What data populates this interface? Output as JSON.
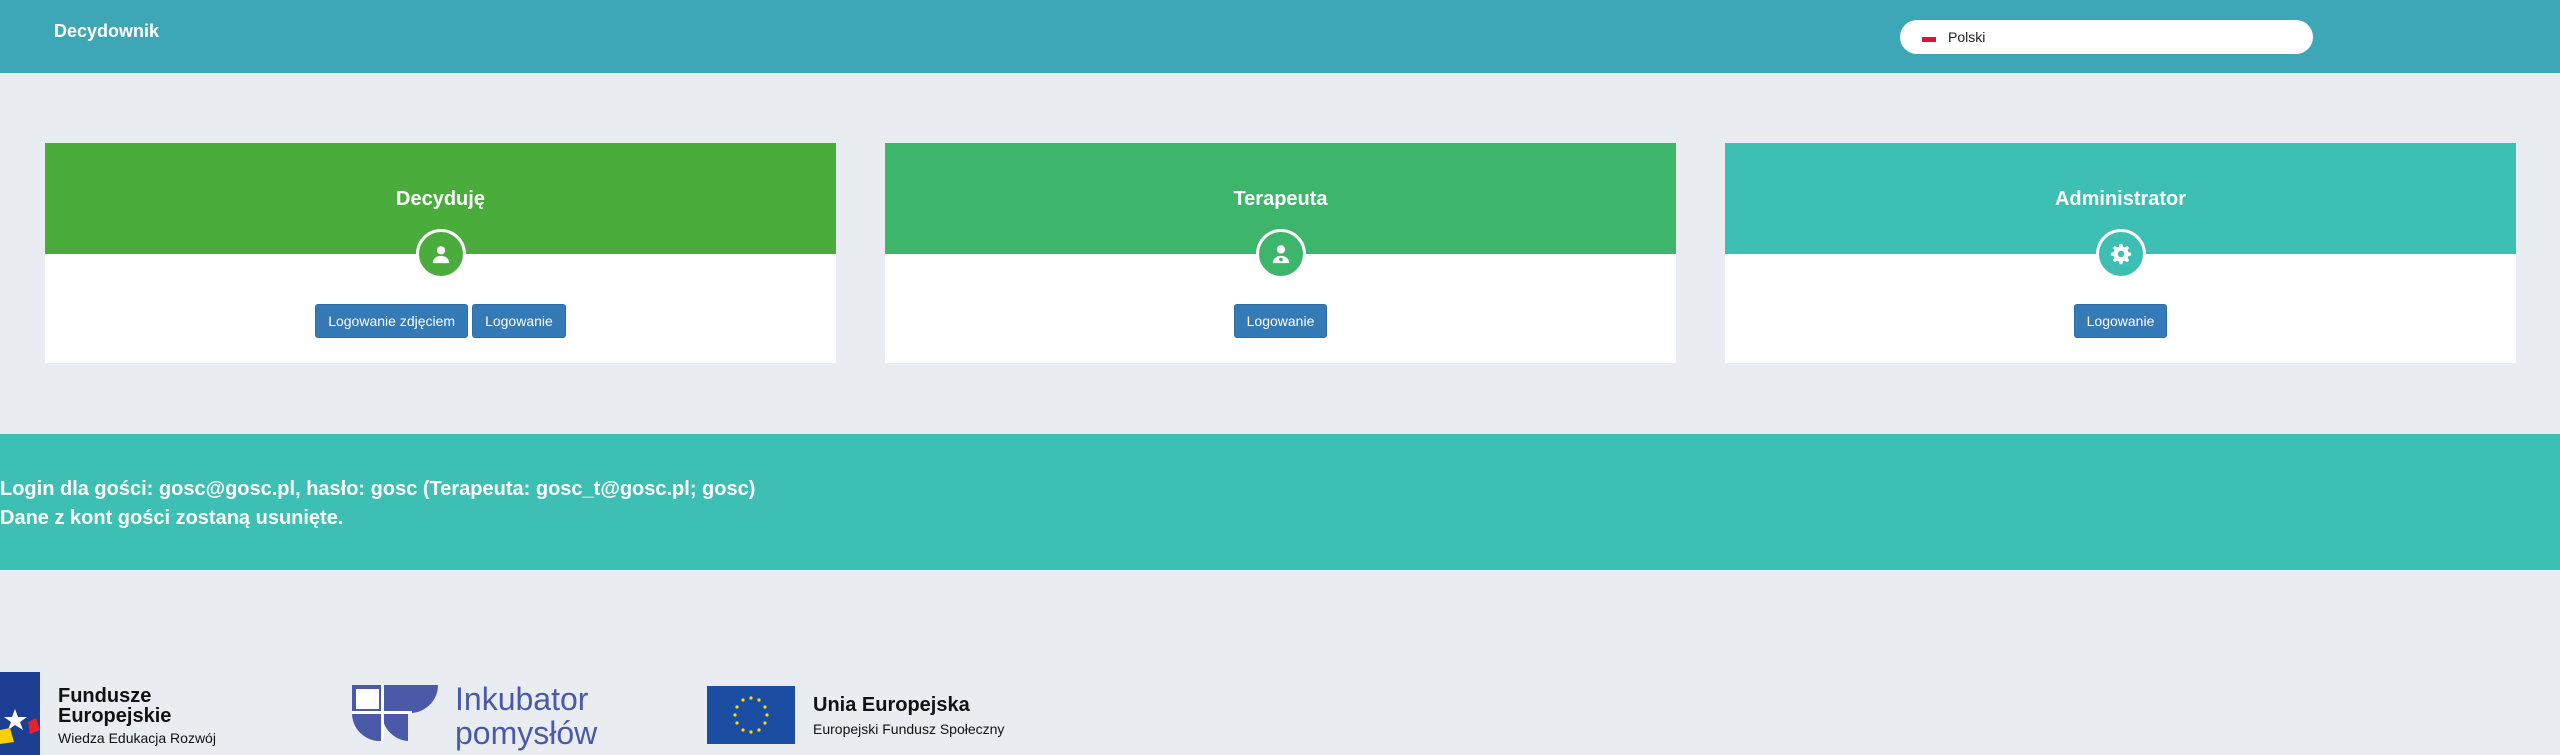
{
  "header": {
    "brand": "Decydownik",
    "language": {
      "label": "Polski"
    }
  },
  "cards": [
    {
      "title": "Decyduję",
      "color": "#4aad3b",
      "icon": "user-icon",
      "buttons": [
        "Logowanie zdjęciem",
        "Logowanie"
      ]
    },
    {
      "title": "Terapeuta",
      "color": "#3db66c",
      "icon": "user-md-icon",
      "buttons": [
        "Logowanie"
      ]
    },
    {
      "title": "Administrator",
      "color": "#3dbfb3",
      "icon": "gear-icon",
      "buttons": [
        "Logowanie"
      ]
    }
  ],
  "guest_info": {
    "line1": "Login dla gości: gosc@gosc.pl, hasło: gosc (Terapeuta: gosc_t@gosc.pl; gosc)",
    "line2": "Dane z kont gości zostaną usunięte."
  },
  "footer_logos": {
    "fundusze": {
      "line1": "Fundusze",
      "line2": "Europejskie",
      "line3": "Wiedza Edukacja Rozwój"
    },
    "inkubator": {
      "line1": "Inkubator",
      "line2": "pomysłów"
    },
    "ue": {
      "line1": "Unia Europejska",
      "line2": "Europejski Fundusz Społeczny"
    }
  },
  "colors": {
    "topbar": "#3ea7b7",
    "background": "#e9ecf1",
    "button": "#337ab7",
    "info_band": "#3dbfb3"
  }
}
